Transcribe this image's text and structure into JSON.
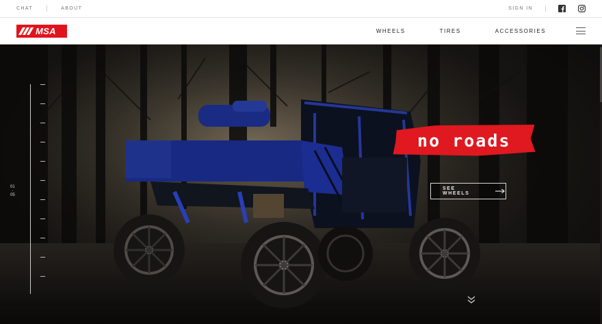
{
  "topbar": {
    "chat_label": "CHAT",
    "about_label": "ABOUT",
    "signin_label": "SIGN IN",
    "social_icons": [
      "facebook-icon",
      "instagram-icon"
    ]
  },
  "navbar": {
    "logo_text": "MSA",
    "brand_color": "#e1141d",
    "links": [
      {
        "label": "WHEELS"
      },
      {
        "label": "TIRES"
      },
      {
        "label": "ACCESSORIES"
      }
    ],
    "menu_icon": "hamburger-icon"
  },
  "hero": {
    "tagline": "no roads",
    "tagline_color": "#e01820",
    "cta_label": "SEE WHEELS",
    "slide_current": "01",
    "slide_total": "05",
    "vehicle_color": "#1f36a8",
    "scroll_icon": "double-chevron-down-icon"
  }
}
